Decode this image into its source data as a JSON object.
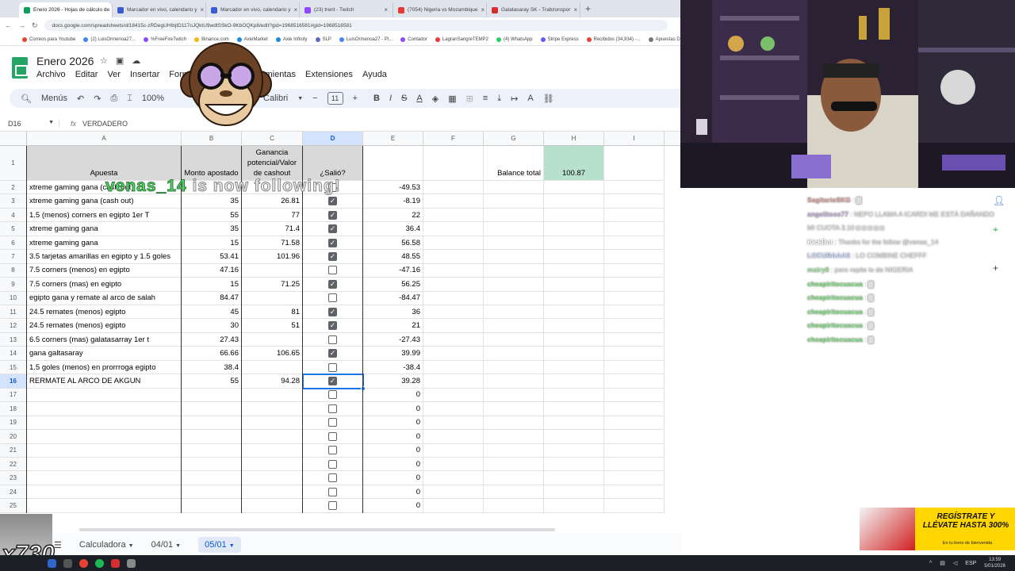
{
  "browser": {
    "tabs": [
      {
        "label": "Enero 2026 - Hojas de cálculo de",
        "color": "#0f9d58",
        "active": true
      },
      {
        "label": "Marcador en vivo, calendario y",
        "color": "#3c5bd1",
        "active": false
      },
      {
        "label": "Marcador en vivo, calendario y",
        "color": "#3c5bd1",
        "active": false
      },
      {
        "label": "(23) trent - Twitch",
        "color": "#9146ff",
        "active": false
      },
      {
        "label": "(7054) Nigeria vs Mozambique",
        "color": "#e53935",
        "active": false
      },
      {
        "label": "Galatasaray SK - Trabzonspor",
        "color": "#d32f2f",
        "active": false
      }
    ],
    "url": "docs.google.com/spreadsheets/d/18415c-zRDegUHIbjtD117oJQktU9wdtSSkO-9KbOQKp8/edit?gid=1968516581#gid=1968516581",
    "bookmarks": [
      {
        "label": "Correos para Youtube",
        "color": "#ea4335"
      },
      {
        "label": "(2) LuisOrmenoa27...",
        "color": "#4285f4"
      },
      {
        "label": "%FreeFireTwitch",
        "color": "#9146ff"
      },
      {
        "label": "Binance.com",
        "color": "#f0b90b"
      },
      {
        "label": "AxieMarket",
        "color": "#1e88e5"
      },
      {
        "label": "Axie Infinity",
        "color": "#1e88e5"
      },
      {
        "label": "SLP",
        "color": "#5c6bc0"
      },
      {
        "label": "LuisOrmenoa27 - Pl...",
        "color": "#4285f4"
      },
      {
        "label": "Contador",
        "color": "#9146ff"
      },
      {
        "label": "LagranSangreTEMP2",
        "color": "#e53935"
      },
      {
        "label": "(4) WhatsApp",
        "color": "#25d366"
      },
      {
        "label": "Stripe Express",
        "color": "#635bff"
      },
      {
        "label": "Recibidos (34,934) -...",
        "color": "#ea4335"
      },
      {
        "label": "Apuestas Depo...",
        "color": "#777777"
      }
    ]
  },
  "sheets": {
    "title": "Enero 2026",
    "menu": [
      "Archivo",
      "Editar",
      "Ver",
      "Insertar",
      "Formato",
      "Datos",
      "Herramientas",
      "Extensiones",
      "Ayuda"
    ],
    "toolbar": {
      "menus": "Menús",
      "zoom": "100%",
      "format_num": "123",
      "font": "Calibri",
      "font_size": "11"
    },
    "namebox": "D16",
    "formula": "VERDADERO",
    "columns": [
      "A",
      "B",
      "C",
      "D",
      "E",
      "F",
      "G",
      "H",
      "I"
    ],
    "headers": {
      "a": "Apuesta",
      "b": "Monto apostado",
      "c": "Ganancia potencial/Valor de cashout",
      "d": "¿Salió?"
    },
    "balance_label": "Balance total",
    "balance_value": "100.87",
    "rows": [
      {
        "n": "2",
        "a": "xtreme gaming gana (cash out)",
        "b": "",
        "c": "",
        "d": false,
        "e": "-49.53"
      },
      {
        "n": "3",
        "a": "xtreme gaming gana (cash out)",
        "b": "35",
        "c": "26.81",
        "d": true,
        "e": "-8.19"
      },
      {
        "n": "4",
        "a": "1.5 (menos) corners en egipto 1er T",
        "b": "55",
        "c": "77",
        "d": true,
        "e": "22"
      },
      {
        "n": "5",
        "a": "xtreme gaming gana",
        "b": "35",
        "c": "71.4",
        "d": true,
        "e": "36.4"
      },
      {
        "n": "6",
        "a": "xtreme gaming gana",
        "b": "15",
        "c": "71.58",
        "d": true,
        "e": "56.58"
      },
      {
        "n": "7",
        "a": "3.5 tarjetas amarillas en egipto y 1.5 goles",
        "b": "53.41",
        "c": "101.96",
        "d": true,
        "e": "48.55"
      },
      {
        "n": "8",
        "a": "7.5 corners (menos) en egipto",
        "b": "47.16",
        "c": "",
        "d": false,
        "e": "-47.16"
      },
      {
        "n": "9",
        "a": "7.5 corners (mas) en egipto",
        "b": "15",
        "c": "71.25",
        "d": true,
        "e": "56.25"
      },
      {
        "n": "10",
        "a": "egipto gana y remate al arco de salah",
        "b": "84.47",
        "c": "",
        "d": false,
        "e": "-84.47"
      },
      {
        "n": "11",
        "a": "24.5 remates (menos) egipto",
        "b": "45",
        "c": "81",
        "d": true,
        "e": "36"
      },
      {
        "n": "12",
        "a": "24.5 remates (menos) egipto",
        "b": "30",
        "c": "51",
        "d": true,
        "e": "21"
      },
      {
        "n": "13",
        "a": "6.5 corners (mas) galatasarray 1er t",
        "b": "27.43",
        "c": "",
        "d": false,
        "e": "-27.43"
      },
      {
        "n": "14",
        "a": "gana galtasaray",
        "b": "66.66",
        "c": "106.65",
        "d": true,
        "e": "39.99"
      },
      {
        "n": "15",
        "a": "1.5 goles (menos) en prorrroga egipto",
        "b": "38.4",
        "c": "",
        "d": false,
        "e": "-38.4"
      },
      {
        "n": "16",
        "a": "RERMATE AL ARCO DE AKGUN",
        "b": "55",
        "c": "94.28",
        "d": true,
        "e": "39.28"
      },
      {
        "n": "17",
        "a": "",
        "b": "",
        "c": "",
        "d": false,
        "e": "0"
      },
      {
        "n": "18",
        "a": "",
        "b": "",
        "c": "",
        "d": false,
        "e": "0"
      },
      {
        "n": "19",
        "a": "",
        "b": "",
        "c": "",
        "d": false,
        "e": "0"
      },
      {
        "n": "20",
        "a": "",
        "b": "",
        "c": "",
        "d": false,
        "e": "0"
      },
      {
        "n": "21",
        "a": "",
        "b": "",
        "c": "",
        "d": false,
        "e": "0"
      },
      {
        "n": "22",
        "a": "",
        "b": "",
        "c": "",
        "d": false,
        "e": "0"
      },
      {
        "n": "23",
        "a": "",
        "b": "",
        "c": "",
        "d": false,
        "e": "0"
      },
      {
        "n": "24",
        "a": "",
        "b": "",
        "c": "",
        "d": false,
        "e": "0"
      },
      {
        "n": "25",
        "a": "",
        "b": "",
        "c": "",
        "d": false,
        "e": "0"
      }
    ],
    "sheet_tabs": [
      {
        "label": "Calculadora",
        "active": false
      },
      {
        "label": "04/01",
        "active": false
      },
      {
        "label": "05/01",
        "active": true
      }
    ]
  },
  "overlay": {
    "follow_name": "venas_14",
    "follow_text": "is now following!",
    "ad_title": "REGÍSTRATE Y LLÉVATE HASTA 300%",
    "ad_sub": "En tu bono de bienvenida",
    "viewer_badge": "x730"
  },
  "chat": [
    {
      "user": "SagitarioSKG",
      "msg": ": ▇",
      "ucolor": "#e0a0a0"
    },
    {
      "user": "angelitoos77",
      "msg": ": NEPO LLAMA A ICARDI ME ESTÁ DAÑANDO MI CUOTA 3.10 ◘ ◘ ◘ ◘ ◘",
      "ucolor": "#c9b2d6"
    },
    {
      "user": "KickBot",
      "msg": ": Thanks for the follow @venas_14",
      "ucolor": "#ffffff"
    },
    {
      "user": "LOCURAAAS",
      "msg": ": LO COMBINE CHEFFF",
      "ucolor": "#c7d8ff"
    },
    {
      "user": "mairy8",
      "msg": ": pero repite lo de NIGERIA",
      "ucolor": "#a8e6a8"
    },
    {
      "user": "cheapiritocuacua",
      "msg": ": ▇",
      "ucolor": "#7fe07f"
    },
    {
      "user": "cheapiritocuacua",
      "msg": ": ▇",
      "ucolor": "#7fe07f"
    },
    {
      "user": "cheapiritocuacua",
      "msg": ": ▇",
      "ucolor": "#7fe07f"
    },
    {
      "user": "cheapiritocuacua",
      "msg": ": ▇",
      "ucolor": "#7fe07f"
    },
    {
      "user": "cheapiritocuacua",
      "msg": ": ▇",
      "ucolor": "#7fe07f"
    }
  ],
  "taskbar": {
    "lang": "ESP",
    "time": "13:59",
    "date": "5/01/2026"
  }
}
